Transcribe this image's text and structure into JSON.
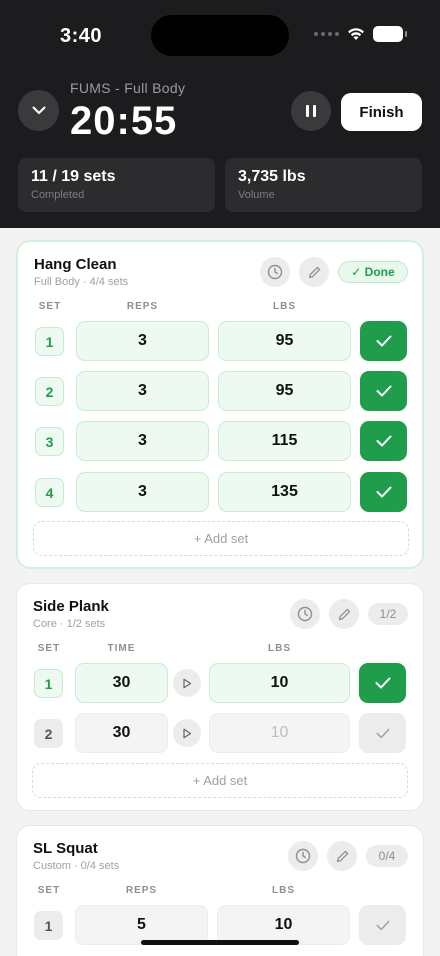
{
  "status": {
    "time": "3:40"
  },
  "header": {
    "workout_name": "FUMS - Full Body",
    "timer": "20:55",
    "finish_label": "Finish"
  },
  "stats": [
    {
      "value": "11 / 19 sets",
      "label": "Completed"
    },
    {
      "value": "3,735 lbs",
      "label": "Volume"
    }
  ],
  "exercises": [
    {
      "title": "Hang Clean",
      "subtitle": "Full Body · 4/4 sets",
      "status": "✓ Done",
      "columns": [
        "SET",
        "REPS",
        "LBS"
      ],
      "sets": [
        {
          "num": "1",
          "reps": "3",
          "lbs": "95"
        },
        {
          "num": "2",
          "reps": "3",
          "lbs": "95"
        },
        {
          "num": "3",
          "reps": "3",
          "lbs": "115"
        },
        {
          "num": "4",
          "reps": "3",
          "lbs": "135"
        }
      ],
      "add_set": "+ Add set"
    },
    {
      "title": "Side Plank",
      "subtitle": "Core · 1/2 sets",
      "status": "1/2",
      "columns": [
        "SET",
        "TIME",
        "LBS"
      ],
      "sets": [
        {
          "num": "1",
          "time": "30",
          "lbs": "10"
        },
        {
          "num": "2",
          "time": "30",
          "lbs": "10"
        }
      ],
      "add_set": "+ Add set"
    },
    {
      "title": "SL Squat",
      "subtitle": "Custom · 0/4 sets",
      "status": "0/4",
      "columns": [
        "SET",
        "REPS",
        "LBS"
      ],
      "sets": [
        {
          "num": "1",
          "reps": "5",
          "lbs": "10"
        }
      ]
    }
  ],
  "colors": {
    "accent_green": "#1f9d4b",
    "header_bg": "#1c1c1e"
  }
}
